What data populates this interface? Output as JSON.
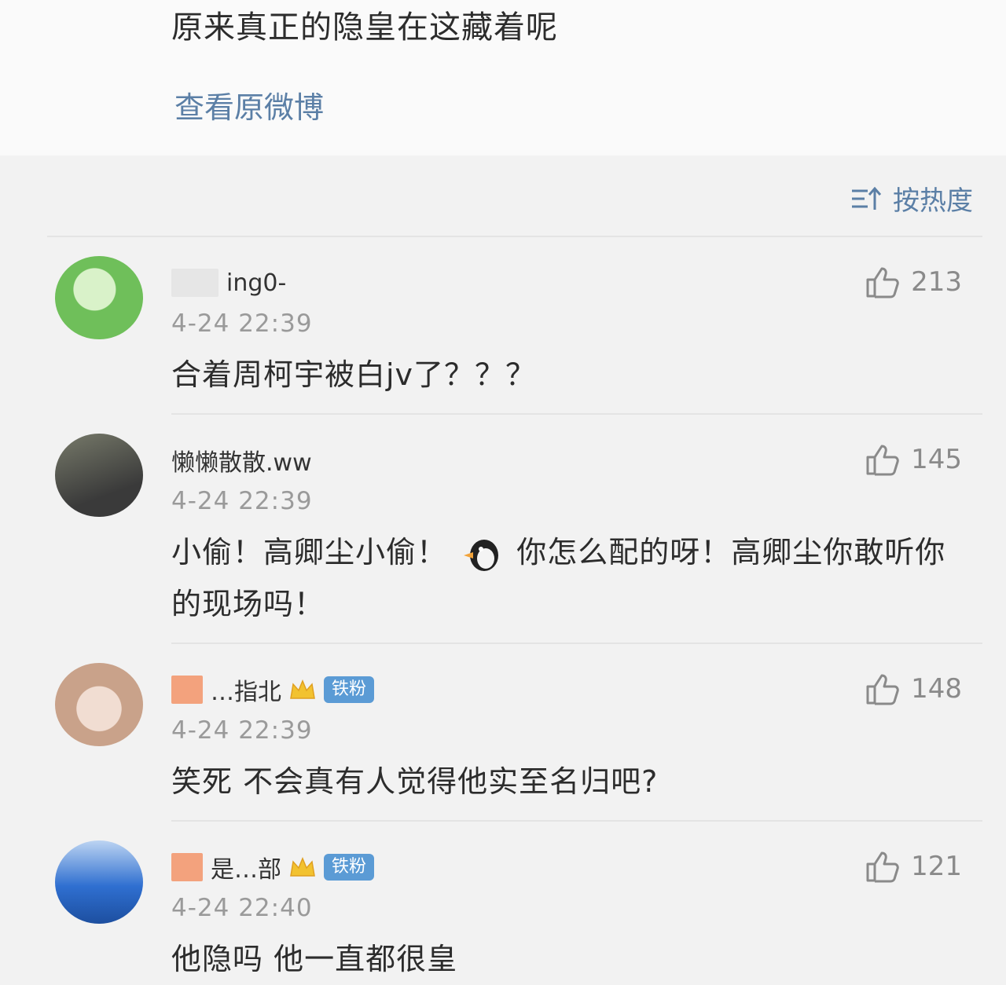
{
  "post": {
    "text": "原来真正的隐皇在这藏着呢",
    "view_original": "查看原微博"
  },
  "sort": {
    "label": "按热度",
    "icon": "sort-icon"
  },
  "comments": [
    {
      "name": "ing0-",
      "time": "4-24 22:39",
      "text": "合着周柯宇被白jv了？？？",
      "likes": "213",
      "avatar_colors": [
        "#6fbf5a",
        "#d9f2c9"
      ]
    },
    {
      "name": "懒懒散散.ww",
      "time": "4-24 22:39",
      "text_a": "小偷！高卿尘小偷！",
      "text_b": "你怎么配的呀！高卿尘你敢听你的现场吗！",
      "likes": "145",
      "avatar_colors": [
        "#3a3a3a",
        "#777a6a"
      ]
    },
    {
      "name": "…指北",
      "badge": "铁粉",
      "time": "4-24 22:39",
      "text": "笑死 不会真有人觉得他实至名归吧?",
      "likes": "148",
      "avatar_colors": [
        "#c9a28a",
        "#f1ddd2"
      ]
    },
    {
      "name": "是…部",
      "badge": "铁粉",
      "time": "4-24 22:40",
      "text": "他隐吗 他一直都很皇",
      "likes": "121",
      "avatar_colors": [
        "#2f6fd0",
        "#bcd4f2"
      ]
    }
  ],
  "colors": {
    "link": "#5b7fa6",
    "badge": "#5b9bd5",
    "mask": "#f3a27d"
  }
}
